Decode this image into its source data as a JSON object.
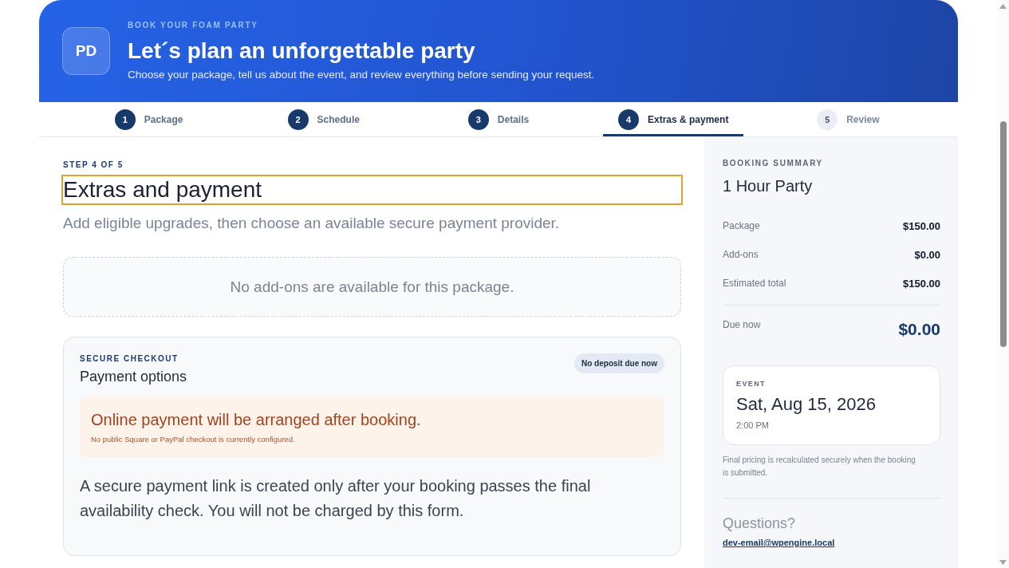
{
  "header": {
    "logo": "PD",
    "eyebrow": "BOOK YOUR FOAM PARTY",
    "title": "Let´s plan an unforgettable party",
    "subtitle": "Choose your package, tell us about the event, and review everything before sending your request."
  },
  "steps": [
    {
      "number": "1",
      "label": "Package",
      "completed": true,
      "selected": false
    },
    {
      "number": "2",
      "label": "Schedule",
      "completed": true,
      "selected": false
    },
    {
      "number": "3",
      "label": "Details",
      "completed": true,
      "selected": false
    },
    {
      "number": "4",
      "label": "Extras & payment",
      "completed": false,
      "selected": true
    },
    {
      "number": "5",
      "label": "Review",
      "completed": false,
      "selected": false
    }
  ],
  "main": {
    "eyebrow": "STEP 4 OF 5",
    "heading": {
      "text": "Extras and payment",
      "focused": true
    },
    "intro": "Add eligible upgrades, then choose an available secure payment provider.",
    "addons_empty": "No add-ons are available for this package.",
    "payment": {
      "eyebrow": "SECURE CHECKOUT",
      "title": "Payment options",
      "badge": "No deposit due now",
      "notice": {
        "title": "Online payment will be arranged after booking.",
        "detail": "No public Square or PayPal checkout is currently configured."
      },
      "body": "A secure payment link is created only after your booking passes the final availability check. You will not be charged by this form."
    }
  },
  "summary": {
    "eyebrow": "BOOKING SUMMARY",
    "package_name": "1 Hour Party",
    "lines": [
      {
        "label": "Package",
        "value": "$150.00"
      },
      {
        "label": "Add-ons",
        "value": "$0.00"
      },
      {
        "label": "Estimated total",
        "value": "$150.00"
      }
    ],
    "due": {
      "label": "Due now",
      "value": "$0.00"
    },
    "event": {
      "eyebrow": "EVENT",
      "date": "Sat, Aug 15, 2026",
      "time": "2:00 PM"
    },
    "note": "Final pricing is recalculated securely when the booking is submitted.",
    "questions": "Questions?",
    "email": "dev-email@wpengine.local"
  }
}
